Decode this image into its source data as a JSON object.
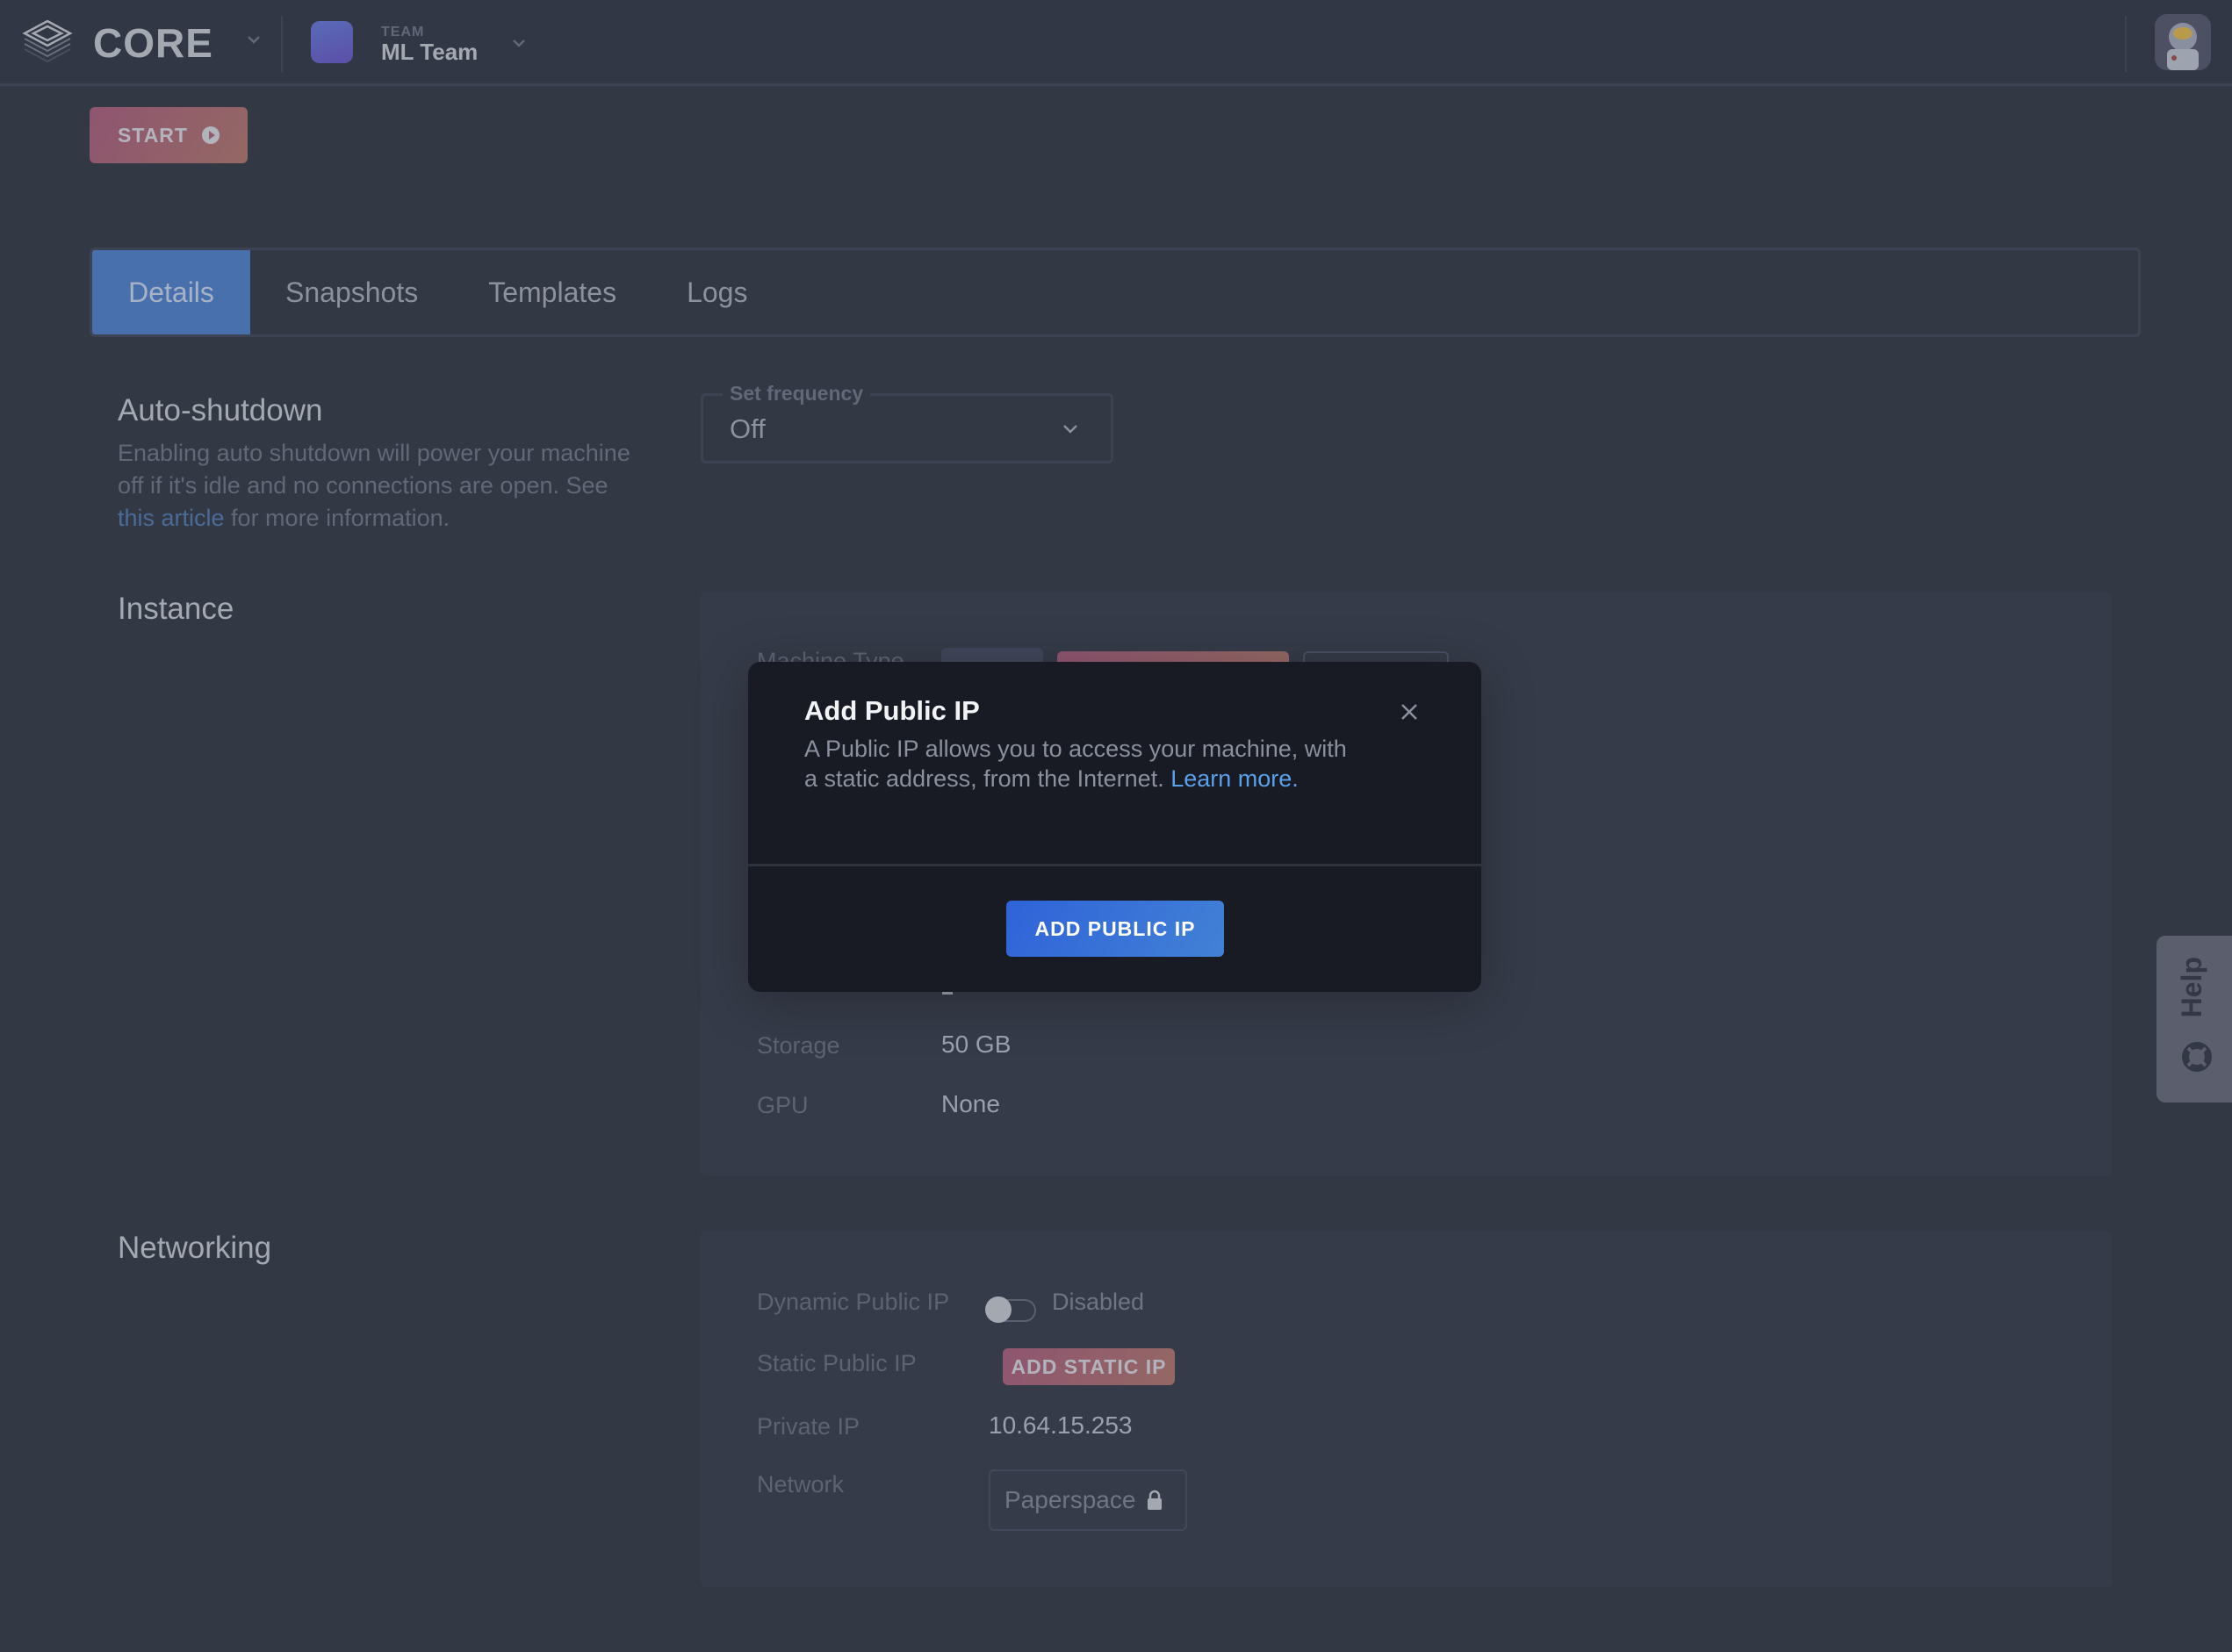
{
  "header": {
    "brand": "CORE",
    "team_caption": "TEAM",
    "team_name": "ML Team",
    "icons": [
      "layers-logo-icon",
      "chevron-down-icon",
      "team-avatar",
      "user-avatar-astronaut"
    ]
  },
  "actions": {
    "start_label": "START",
    "start_icon": "play-circle-icon"
  },
  "tabs": [
    {
      "label": "Details",
      "active": true
    },
    {
      "label": "Snapshots",
      "active": false
    },
    {
      "label": "Templates",
      "active": false
    },
    {
      "label": "Logs",
      "active": false
    }
  ],
  "auto_shutdown": {
    "title": "Auto-shutdown",
    "desc_before": "Enabling auto shutdown will power your machine off if it's idle and no connections are open. See ",
    "desc_link": "this article",
    "desc_after": " for more information.",
    "frequency_label": "Set frequency",
    "frequency_value": "Off"
  },
  "instance": {
    "title": "Instance",
    "partially_hidden_label": "Machine Type",
    "rows": [
      {
        "label": "Storage",
        "value": "50 GB"
      },
      {
        "label": "GPU",
        "value": "None"
      }
    ]
  },
  "networking": {
    "title": "Networking",
    "dynamic_ip_label": "Dynamic Public IP",
    "dynamic_ip_state": "Disabled",
    "dynamic_ip_enabled": false,
    "static_ip_label": "Static Public IP",
    "static_ip_button": "ADD STATIC IP",
    "private_ip_label": "Private IP",
    "private_ip_value": "10.64.15.253",
    "network_label": "Network",
    "network_value": "Paperspace",
    "network_icon": "lock-icon"
  },
  "modal": {
    "title": "Add Public IP",
    "body": "A Public IP allows you to access your machine, with a static address, from the Internet. ",
    "link": "Learn more.",
    "button": "ADD PUBLIC IP",
    "close_icon": "close-icon"
  },
  "help": {
    "label": "Help",
    "icon": "lifebuoy-icon"
  },
  "colors": {
    "background": "#333845",
    "accent_blue": "#4870ad",
    "primary_button": "#2f63d8",
    "gradient_button": "#8f5570",
    "link": "#5aa0ea",
    "modal_bg": "#181b23"
  }
}
